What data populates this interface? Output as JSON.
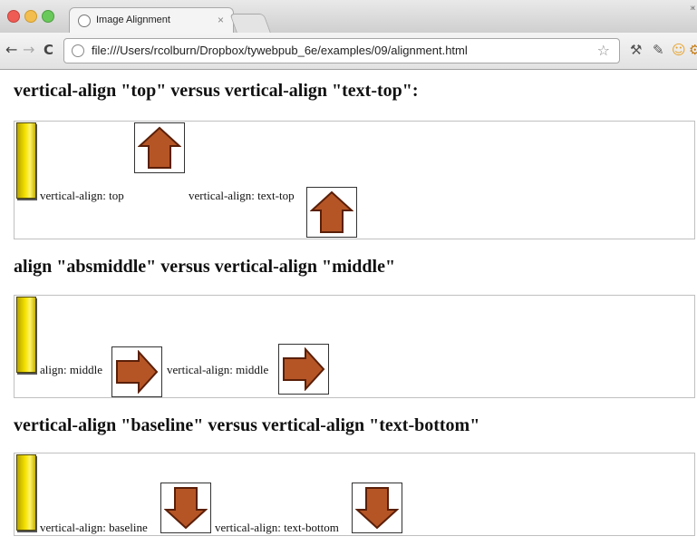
{
  "browser": {
    "tab_title": "Image Alignment",
    "tab_close": "×",
    "url": "file:///Users/rcolburn/Dropbox/tywebpub_6e/examples/09/alignment.html",
    "corner_label": "ж",
    "icons": [
      "back-arrow-icon",
      "forward-arrow-icon",
      "reload-icon",
      "page-icon",
      "star-icon",
      "wrench-icon",
      "pin-icon",
      "face-icon",
      "tool-icon"
    ]
  },
  "sections": [
    {
      "heading": "vertical-align \"top\" versus vertical-align \"text-top\":",
      "label1": "vertical-align: top",
      "label2": "vertical-align: text-top",
      "arrow": "up"
    },
    {
      "heading": "align \"absmiddle\" versus vertical-align \"middle\"",
      "label1": "align: middle",
      "label2": "vertical-align: middle",
      "arrow": "right"
    },
    {
      "heading": "vertical-align \"baseline\" versus vertical-align \"text-bottom\"",
      "label1": "vertical-align: baseline",
      "label2": "vertical-align: text-bottom",
      "arrow": "down"
    }
  ],
  "colors": {
    "arrow_fill": "#b55526",
    "arrow_stroke": "#5a1f08",
    "bar_fill": "#f5e300"
  }
}
